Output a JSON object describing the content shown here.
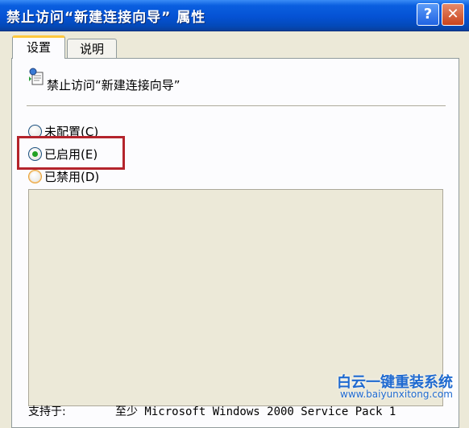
{
  "window": {
    "title": "禁止访问“新建连接向导” 属性",
    "help_label": "?",
    "close_label": "✕"
  },
  "tabs": [
    {
      "label": "设置",
      "selected": true
    },
    {
      "label": "说明",
      "selected": false
    }
  ],
  "policy": {
    "icon": "policy-icon",
    "name": "禁止访问“新建连接向导”"
  },
  "options": [
    {
      "label": "未配置(C)",
      "checked": false
    },
    {
      "label": "已启用(E)",
      "checked": true
    },
    {
      "label": "已禁用(D)",
      "checked": false
    }
  ],
  "support": {
    "label": "支持于:",
    "value": "至少 Microsoft Windows 2000 Service Pack 1"
  },
  "watermark": {
    "text": "白云一键重装系统",
    "url": "www.baiyunxitong.com"
  },
  "colors": {
    "titlebar": "#0552d4",
    "highlight": "#b4242c",
    "active_tab_top": "#ffc83c",
    "watermark": "#1f6ad0"
  }
}
